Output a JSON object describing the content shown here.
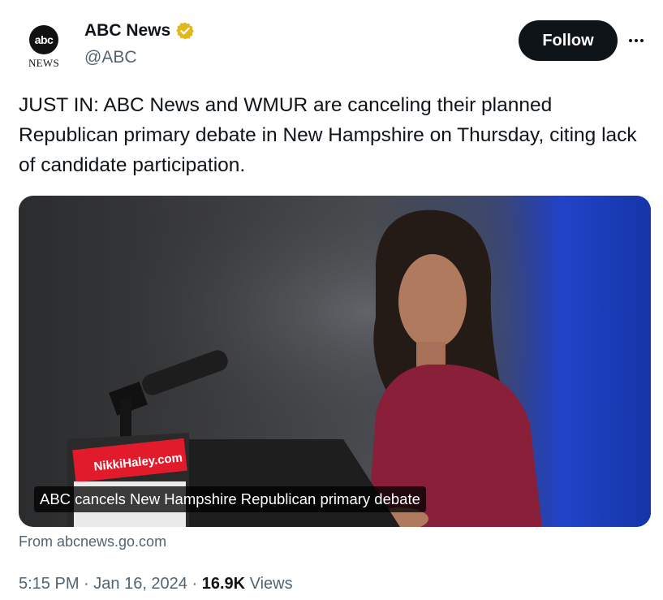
{
  "author": {
    "logo_text": "abc",
    "logo_subtext": "NEWS",
    "display_name": "ABC News",
    "handle": "@ABC",
    "verified_color": "#e2b719"
  },
  "actions": {
    "follow_label": "Follow",
    "more_icon": "ellipsis-icon"
  },
  "tweet": {
    "text": "JUST IN: ABC News and WMUR are canceling their planned Republican primary debate in New Hampshire on Thursday, citing lack of candidate participation."
  },
  "card": {
    "caption": "ABC cancels New Hampshire Republican primary debate",
    "podium_sign": "NikkiHaley.com",
    "source": "From abcnews.go.com"
  },
  "meta": {
    "time": "5:15 PM",
    "separator1": " · ",
    "date": "Jan 16, 2024",
    "separator2": " · ",
    "views_count": "16.9K",
    "views_label": " Views"
  },
  "colors": {
    "text": "#0f1419",
    "secondary": "#536471",
    "follow_bg": "#0f1419"
  }
}
